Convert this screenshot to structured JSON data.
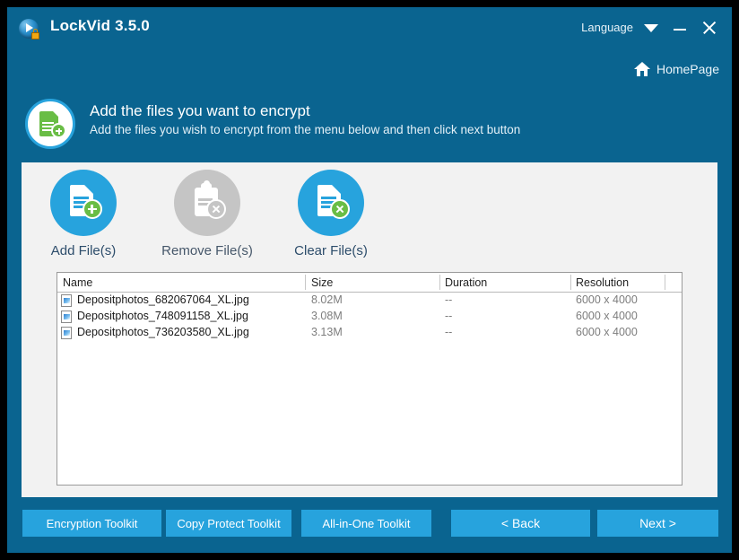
{
  "window": {
    "title": "LockVid 3.5.0",
    "logo_icon": "play-lock-icon",
    "language_label": "Language",
    "language_caret_icon": "chevron-down-icon",
    "minimize_icon": "minimize-icon",
    "close_icon": "close-icon",
    "homepage_label": "HomePage",
    "homepage_icon": "home-icon"
  },
  "header": {
    "icon": "add-document-icon",
    "title": "Add the files you want to encrypt",
    "subtitle": "Add the files you wish to encrypt from the menu below and then click next button"
  },
  "toolbar": {
    "buttons": [
      {
        "label": "Add File(s)",
        "icon": "document-add-icon",
        "enabled": true
      },
      {
        "label": "Remove File(s)",
        "icon": "clipboard-remove-icon",
        "enabled": false
      },
      {
        "label": "Clear File(s)",
        "icon": "document-clear-icon",
        "enabled": true
      }
    ]
  },
  "file_list": {
    "columns": [
      "Name",
      "Size",
      "Duration",
      "Resolution"
    ],
    "rows": [
      {
        "name": "Depositphotos_682067064_XL.jpg",
        "size": "8.02M",
        "duration": "--",
        "resolution": "6000 x 4000",
        "icon": "image-file-icon"
      },
      {
        "name": "Depositphotos_748091158_XL.jpg",
        "size": "3.08M",
        "duration": "--",
        "resolution": "6000 x 4000",
        "icon": "image-file-icon"
      },
      {
        "name": "Depositphotos_736203580_XL.jpg",
        "size": "3.13M",
        "duration": "--",
        "resolution": "6000 x 4000",
        "icon": "image-file-icon"
      }
    ]
  },
  "footer": {
    "encryption_toolkit": "Encryption Toolkit",
    "copy_protect_toolkit": "Copy Protect Toolkit",
    "all_in_one_toolkit": "All-in-One Toolkit",
    "back": "< Back",
    "next": "Next >"
  },
  "colors": {
    "frame": "#0a6490",
    "accent": "#27a3dd",
    "panel": "#f2f2f2",
    "green": "#69bd45",
    "disabled": "#c5c5c5"
  }
}
